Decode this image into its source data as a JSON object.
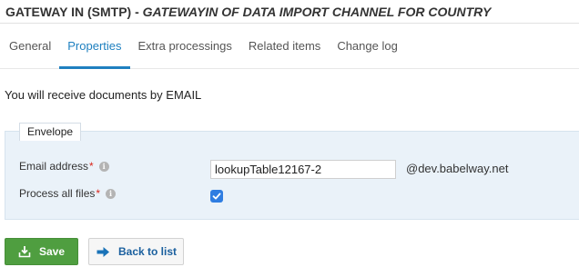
{
  "header": {
    "title": "GATEWAY IN (SMTP)",
    "separator": " - ",
    "subtitle": "GATEWAYIN OF DATA IMPORT CHANNEL FOR COUNTRY"
  },
  "tabs": [
    {
      "label": "General",
      "active": false
    },
    {
      "label": "Properties",
      "active": true
    },
    {
      "label": "Extra processings",
      "active": false
    },
    {
      "label": "Related items",
      "active": false
    },
    {
      "label": "Change log",
      "active": false
    }
  ],
  "intro_text": "You will receive documents by EMAIL",
  "envelope": {
    "legend": "Envelope",
    "email": {
      "label": "Email address",
      "required_mark": "*",
      "value": "lookupTable12167-2",
      "domain": "@dev.babelway.net"
    },
    "process_all": {
      "label": "Process all files",
      "required_mark": "*",
      "checked": true
    }
  },
  "actions": {
    "save_label": "Save",
    "back_label": "Back to list"
  },
  "colors": {
    "accent": "#1f80c0",
    "save_green": "#4f9e40",
    "panel_bg": "#eaf2f9",
    "required_red": "#d9261c",
    "checkbox_blue": "#2f7de1"
  },
  "icons": {
    "info": "info-icon",
    "save": "save-download-icon",
    "back": "arrow-right-icon",
    "check": "checkmark-icon"
  }
}
